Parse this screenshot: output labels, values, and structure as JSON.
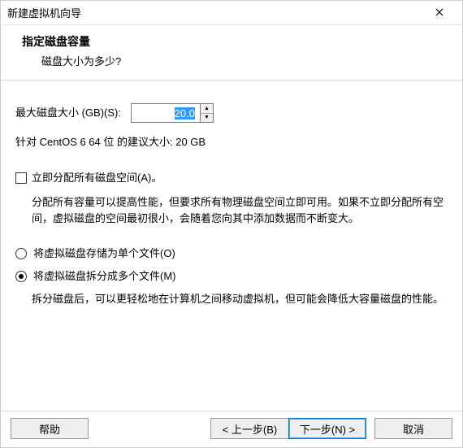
{
  "window": {
    "title": "新建虚拟机向导"
  },
  "header": {
    "title": "指定磁盘容量",
    "subtitle": "磁盘大小为多少?"
  },
  "disk": {
    "label": "最大磁盘大小 (GB)(S):",
    "value": "20.0",
    "suggested": "针对 CentOS 6 64 位 的建议大小: 20 GB"
  },
  "allocate": {
    "checkbox_label": "立即分配所有磁盘空间(A)。",
    "description": "分配所有容量可以提高性能，但要求所有物理磁盘空间立即可用。如果不立即分配所有空间，虚拟磁盘的空间最初很小，会随着您向其中添加数据而不断变大。"
  },
  "split": {
    "single_label": "将虚拟磁盘存储为单个文件(O)",
    "multi_label": "将虚拟磁盘拆分成多个文件(M)",
    "multi_description": "拆分磁盘后，可以更轻松地在计算机之间移动虚拟机，但可能会降低大容量磁盘的性能。"
  },
  "buttons": {
    "help": "帮助",
    "back": "< 上一步(B)",
    "next": "下一步(N) >",
    "cancel": "取消"
  }
}
